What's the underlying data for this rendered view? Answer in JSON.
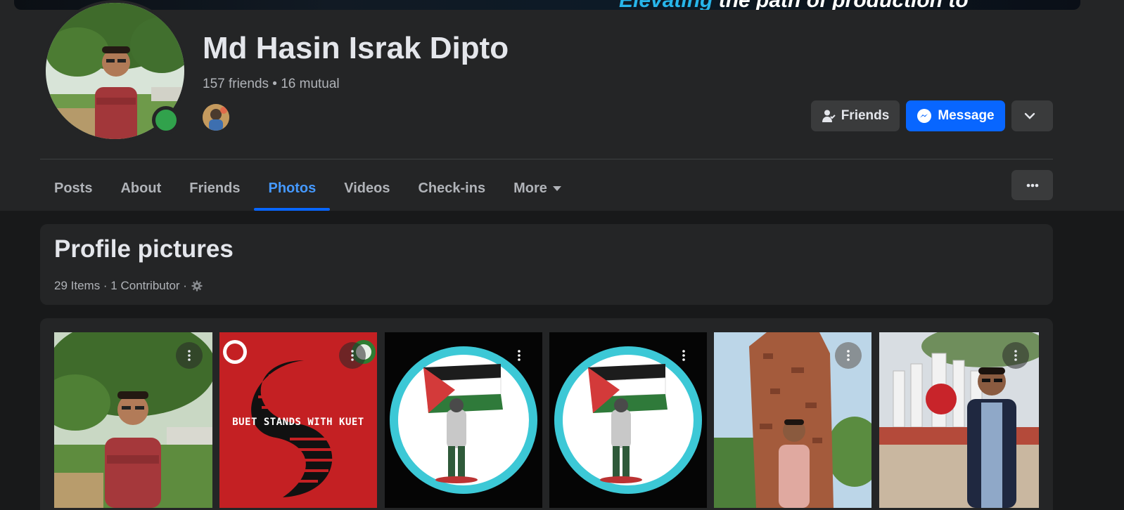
{
  "cover": {
    "text_accent": "Elevating",
    "text_rest": " the path of production to"
  },
  "profile": {
    "name": "Md Hasin Israk Dipto",
    "friends_line": "157 friends • 16 mutual",
    "online_color": "#31a24c"
  },
  "actions": {
    "friends_label": "Friends",
    "message_label": "Message",
    "friends_icon": "person-check-icon",
    "message_icon": "messenger-icon",
    "more_icon": "chevron-down-icon"
  },
  "tabs": [
    {
      "label": "Posts"
    },
    {
      "label": "About"
    },
    {
      "label": "Friends"
    },
    {
      "label": "Photos",
      "active": true
    },
    {
      "label": "Videos"
    },
    {
      "label": "Check-ins"
    },
    {
      "label": "More"
    }
  ],
  "album": {
    "title": "Profile pictures",
    "meta": "29 Items · 1 Contributor ·",
    "privacy_icon": "gear-icon"
  },
  "photos": [
    {
      "description_icon": "photo-portrait-garden"
    },
    {
      "overlay_text": "BUET STANDS WITH KUET"
    },
    {
      "description_icon": "photo-palestine-flag"
    },
    {
      "description_icon": "photo-palestine-flag"
    },
    {
      "description_icon": "photo-brick-ruins"
    },
    {
      "description_icon": "photo-monument-portrait"
    }
  ],
  "colors": {
    "accent": "#0866ff",
    "active_tab": "#4599ff",
    "background": "#18191a",
    "surface": "#242526"
  }
}
